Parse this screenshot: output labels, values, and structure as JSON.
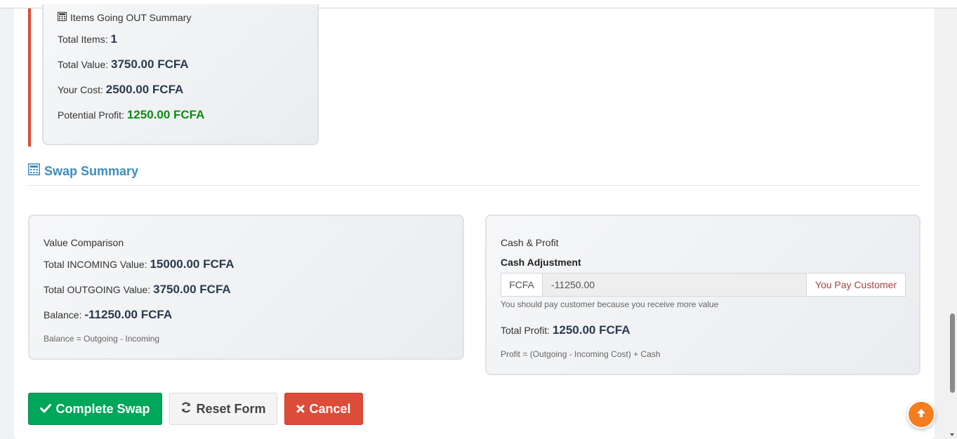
{
  "out_summary": {
    "title": "Items Going OUT Summary",
    "total_items_label": "Total Items:",
    "total_items_value": "1",
    "total_value_label": "Total Value:",
    "total_value_value": "3750.00 FCFA",
    "your_cost_label": "Your Cost:",
    "your_cost_value": "2500.00 FCFA",
    "potential_profit_label": "Potential Profit:",
    "potential_profit_value": "1250.00 FCFA"
  },
  "swap_summary": {
    "title": "Swap Summary"
  },
  "value_comparison": {
    "title": "Value Comparison",
    "incoming_label": "Total INCOMING Value:",
    "incoming_value": "15000.00 FCFA",
    "outgoing_label": "Total OUTGOING Value:",
    "outgoing_value": "3750.00 FCFA",
    "balance_label": "Balance:",
    "balance_value": "-11250.00 FCFA",
    "formula": "Balance = Outgoing - Incoming"
  },
  "cash_profit": {
    "title": "Cash & Profit",
    "cash_adjustment_label": "Cash Adjustment",
    "currency": "FCFA",
    "cash_value": "-11250.00",
    "direction": "You Pay Customer",
    "hint": "You should pay customer because you receive more value",
    "total_profit_label": "Total Profit:",
    "total_profit_value": "1250.00 FCFA",
    "formula": "Profit = (Outgoing - Incoming Cost) + Cash"
  },
  "buttons": {
    "complete": "Complete Swap",
    "reset": "Reset Form",
    "cancel": "Cancel"
  },
  "colors": {
    "accent_blue": "#3c8dbc",
    "success_green": "#00a65a",
    "danger_red": "#dd4b39",
    "profit_green": "#0f8a16",
    "fab_orange": "#f57c1f"
  },
  "icons": {
    "calculator": "calculator-icon",
    "check": "check-icon",
    "refresh": "refresh-icon",
    "times": "times-icon",
    "arrow_up": "arrow-up-icon"
  }
}
